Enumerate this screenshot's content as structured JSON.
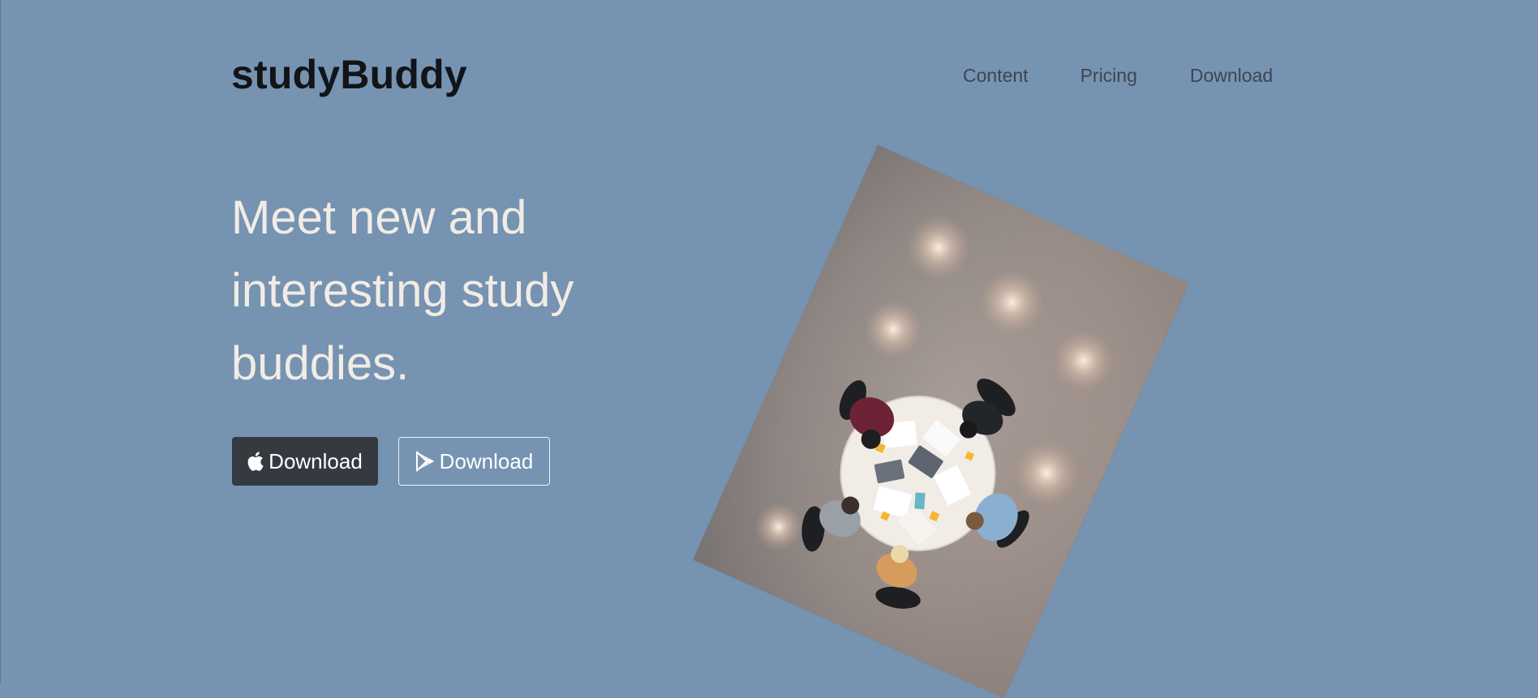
{
  "header": {
    "brand": "studyBuddy",
    "nav": [
      {
        "label": "Content"
      },
      {
        "label": "Pricing"
      },
      {
        "label": "Download"
      }
    ]
  },
  "hero": {
    "headline": "Meet new and interesting study buddies.",
    "buttons": [
      {
        "label": "Download",
        "icon": "apple-icon",
        "style": "dark"
      },
      {
        "label": "Download",
        "icon": "google-play-icon",
        "style": "outline"
      }
    ],
    "image": {
      "semantic": "students-studying-around-round-table-photo"
    }
  },
  "colors": {
    "background": "#7693b2",
    "brand_text": "#111418",
    "headline_text": "#f1ece4",
    "nav_text": "#3e4651",
    "dark_button": "#343a40"
  }
}
